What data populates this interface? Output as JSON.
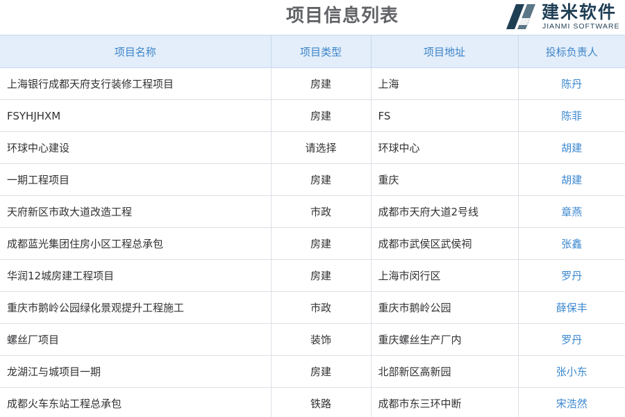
{
  "header": {
    "title": "项目信息列表"
  },
  "brand": {
    "name": "建米软件",
    "sub": "JIANMI SOFTWARE",
    "colors": {
      "dark": "#1f3f55",
      "light": "#5b7686"
    }
  },
  "table": {
    "columns": [
      "项目名称",
      "项目类型",
      "项目地址",
      "投标负责人"
    ],
    "rows": [
      {
        "name": "上海银行成都天府支行装修工程项目",
        "type": "房建",
        "address": "上海",
        "owner": "陈丹"
      },
      {
        "name": "FSYHJHXM",
        "type": "房建",
        "address": "FS",
        "owner": "陈菲"
      },
      {
        "name": "环球中心建设",
        "type": "请选择",
        "address": "环球中心",
        "owner": "胡建"
      },
      {
        "name": "一期工程项目",
        "type": "房建",
        "address": "重庆",
        "owner": "胡建"
      },
      {
        "name": "天府新区市政大道改造工程",
        "type": "市政",
        "address": "成都市天府大道2号线",
        "owner": "章燕"
      },
      {
        "name": "成都蓝光集团住房小区工程总承包",
        "type": "房建",
        "address": "成都市武侯区武侯祠",
        "owner": "张鑫"
      },
      {
        "name": "华润12城房建工程项目",
        "type": "房建",
        "address": "上海市闵行区",
        "owner": "罗丹"
      },
      {
        "name": "重庆市鹅岭公园绿化景观提升工程施工",
        "type": "市政",
        "address": "重庆市鹅岭公园",
        "owner": "薛保丰"
      },
      {
        "name": "螺丝厂项目",
        "type": "装饰",
        "address": "重庆螺丝生产厂内",
        "owner": "罗丹"
      },
      {
        "name": "龙湖江与城项目一期",
        "type": "房建",
        "address": "北部新区高新园",
        "owner": "张小东"
      },
      {
        "name": "成都火车东站工程总承包",
        "type": "铁路",
        "address": "成都市东三环中断",
        "owner": "宋浩然"
      }
    ]
  },
  "colors": {
    "header_bg": "#e3eefa",
    "header_text": "#3e84c8",
    "owner_link": "#3a87cf",
    "title_text": "#606266"
  }
}
